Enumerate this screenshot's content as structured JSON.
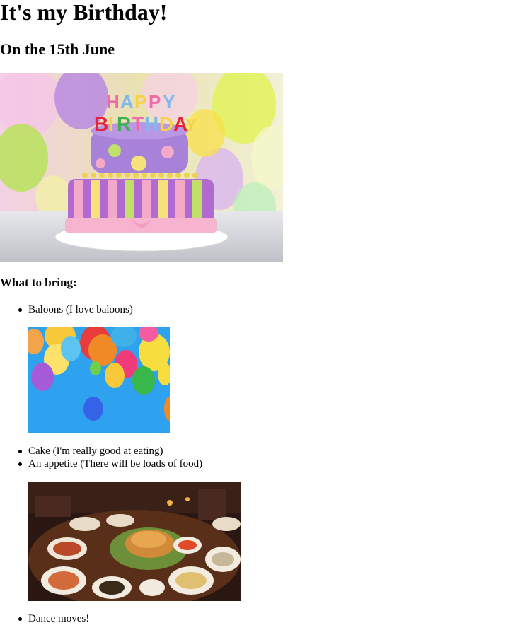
{
  "page": {
    "title": "It's my Birthday!",
    "subtitle": "On the 15th June",
    "bring_heading": "What to bring:"
  },
  "items": [
    {
      "text": "Baloons (I love baloons)",
      "image": "balloons-photo"
    },
    {
      "text": "Cake (I'm really good at eating)"
    },
    {
      "text": "An appetite (There will be loads of food)",
      "image": "feast-photo"
    },
    {
      "text": "Dance moves!"
    }
  ],
  "images": {
    "hero": "birthday-cake-photo",
    "cake_topper_text": "HAPPY BIRTHDAY"
  }
}
